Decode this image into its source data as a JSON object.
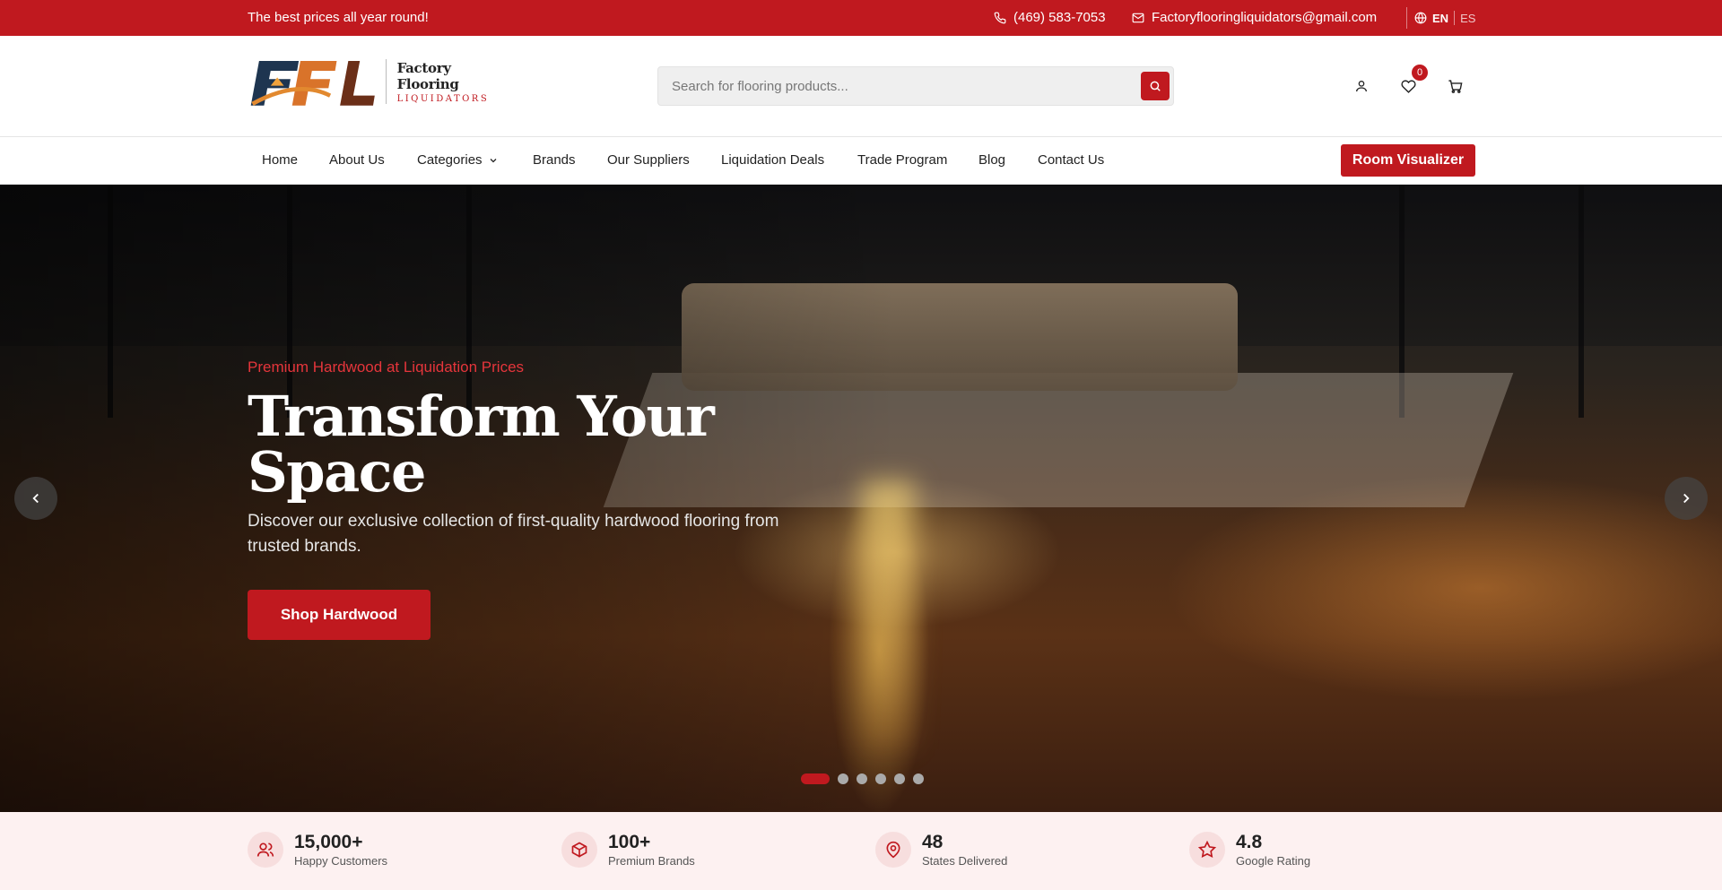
{
  "topbar": {
    "promo": "The best prices all year round!",
    "phone": "(469) 583-7053",
    "email": "Factoryflooringliquidators@gmail.com",
    "lang_active": "EN",
    "lang_other": "ES"
  },
  "header": {
    "logo_text": "FFL",
    "brand_line1": "Factory Flooring",
    "brand_line2": "LIQUIDATORS",
    "search_placeholder": "Search for flooring products...",
    "wishlist_count": "0"
  },
  "nav": {
    "items": [
      "Home",
      "About Us",
      "Categories",
      "Brands",
      "Our Suppliers",
      "Liquidation Deals",
      "Trade Program",
      "Blog",
      "Contact Us"
    ],
    "cta": "Room Visualizer"
  },
  "hero": {
    "eyebrow": "Premium Hardwood at Liquidation Prices",
    "title_line1": "Transform Your",
    "title_line2": "Space",
    "description": "Discover our exclusive collection of first-quality hardwood flooring from trusted brands.",
    "cta": "Shop Hardwood",
    "slide_count": 6,
    "active_slide": 1
  },
  "stats": [
    {
      "number": "15,000+",
      "label": "Happy Customers",
      "icon": "users-icon"
    },
    {
      "number": "100+",
      "label": "Premium Brands",
      "icon": "box-icon"
    },
    {
      "number": "48",
      "label": "States Delivered",
      "icon": "map-pin-icon"
    },
    {
      "number": "4.8",
      "label": "Google Rating",
      "icon": "star-icon"
    }
  ],
  "colors": {
    "brand_red": "#c0191f",
    "stats_bg": "#fdf1f1"
  }
}
